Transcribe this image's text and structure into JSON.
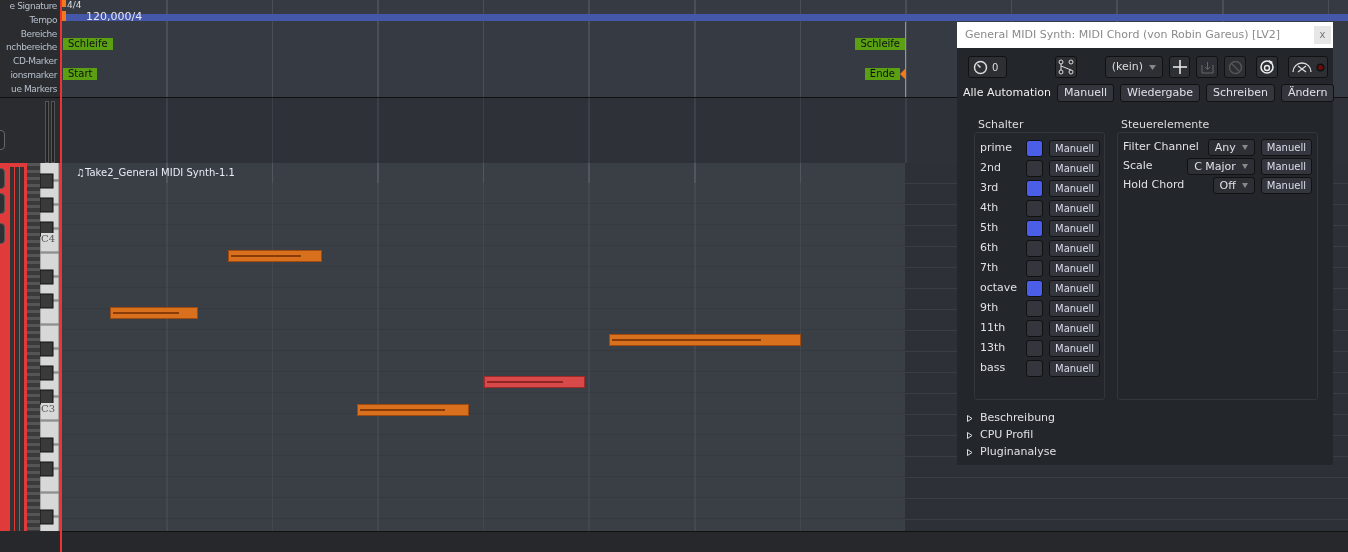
{
  "ruler_labels": [
    "e Signature",
    "Tempo",
    "Bereiche",
    "nchbereiche",
    "CD-Marker",
    "ionsmarker",
    "ue Markers"
  ],
  "meter": "4/4",
  "tempo": "120,000/4",
  "loop": {
    "start": "Schleife",
    "end": "Schleife"
  },
  "session": {
    "start": "Start",
    "end": "Ende"
  },
  "region": {
    "name": "♫Take2_General MIDI Synth-1.1"
  },
  "keyboard_labels": [
    "C4",
    "C3"
  ],
  "notes": [
    {
      "selected": false
    },
    {
      "selected": false
    },
    {
      "selected": false
    },
    {
      "selected": true
    },
    {
      "selected": false
    }
  ],
  "plugin": {
    "title": "General MIDI Synth: MIDI Chord (von Robin Gareus) [LV2]",
    "close": "x",
    "counter": "0",
    "preset": "(kein)",
    "automation_label": "Alle Automation",
    "automation_buttons": [
      "Manuell",
      "Wiedergabe",
      "Schreiben",
      "Ändern"
    ],
    "switches_title": "Schalter",
    "switches": [
      {
        "name": "prime",
        "on": true,
        "button": "Manuell"
      },
      {
        "name": "2nd",
        "on": false,
        "button": "Manuell"
      },
      {
        "name": "3rd",
        "on": true,
        "button": "Manuell"
      },
      {
        "name": "4th",
        "on": false,
        "button": "Manuell"
      },
      {
        "name": "5th",
        "on": true,
        "button": "Manuell"
      },
      {
        "name": "6th",
        "on": false,
        "button": "Manuell"
      },
      {
        "name": "7th",
        "on": false,
        "button": "Manuell"
      },
      {
        "name": "octave",
        "on": true,
        "button": "Manuell"
      },
      {
        "name": "9th",
        "on": false,
        "button": "Manuell"
      },
      {
        "name": "11th",
        "on": false,
        "button": "Manuell"
      },
      {
        "name": "13th",
        "on": false,
        "button": "Manuell"
      },
      {
        "name": "bass",
        "on": false,
        "button": "Manuell"
      }
    ],
    "controls_title": "Steuerelemente",
    "controls": [
      {
        "name": "Filter Channel",
        "value": "Any",
        "button": "Manuell"
      },
      {
        "name": "Scale",
        "value": "C Major",
        "button": "Manuell"
      },
      {
        "name": "Hold Chord",
        "value": "Off",
        "button": "Manuell"
      }
    ],
    "expanders": [
      {
        "label": "Beschreibung",
        "expanded": false
      },
      {
        "label": "CPU Profil",
        "expanded": false
      },
      {
        "label": "Pluginanalyse",
        "expanded": false
      }
    ]
  }
}
